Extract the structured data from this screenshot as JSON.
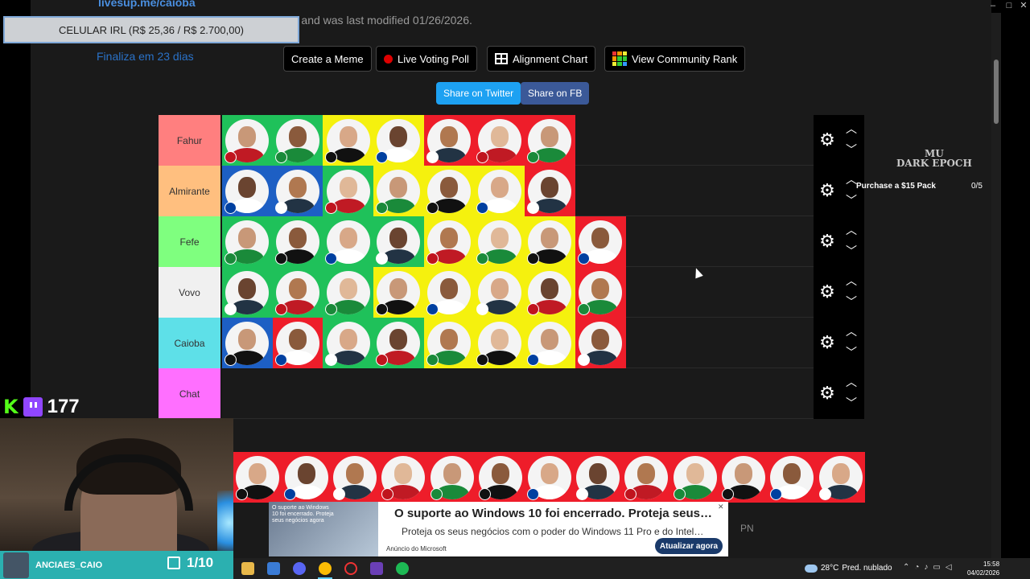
{
  "window": {
    "minimize_glyph": "–",
    "maximize_glyph": "□",
    "close_glyph": "✕"
  },
  "header": {
    "url": "livesup.me/caioba",
    "info": "This tier list has 622 images and was last modified 01/26/2026.",
    "goal": "CELULAR IRL (R$ 25,36 / R$ 2.700,00)",
    "countdown": "Finaliza em 23 dias"
  },
  "toolbar": {
    "create_meme": "Create a Meme",
    "live_poll": "Live Voting Poll",
    "alignment": "Alignment Chart",
    "community": "View Community Rank",
    "share_twitter": "Share on Twitter",
    "share_fb": "Share on FB"
  },
  "colors": {
    "twitter": "#1da1f2",
    "facebook": "#3b5998",
    "tier_fahur": "#ff7f7f",
    "tier_almirante": "#ffbf7f",
    "tier_fefe": "#7fff7f",
    "tier_vovo": "#f0f0f0",
    "tier_caioba": "#5ee0e8",
    "tier_chat": "#ff6fff",
    "chip_green": "#1fc15a",
    "chip_yellow": "#f5f10e",
    "chip_red": "#ee1d2a",
    "chip_blue": "#1d5fc4"
  },
  "tiers": [
    {
      "label": "Fahur",
      "chips": [
        "green",
        "green",
        "yellow",
        "yellow",
        "red",
        "red",
        "red"
      ]
    },
    {
      "label": "Almirante",
      "chips": [
        "blue",
        "blue",
        "green",
        "yellow",
        "yellow",
        "yellow",
        "red"
      ]
    },
    {
      "label": "Fefe",
      "chips": [
        "green",
        "green",
        "green",
        "green",
        "yellow",
        "yellow",
        "yellow",
        "red"
      ]
    },
    {
      "label": "Vovo",
      "chips": [
        "green",
        "green",
        "green",
        "yellow",
        "yellow",
        "yellow",
        "yellow",
        "red"
      ]
    },
    {
      "label": "Caioba",
      "chips": [
        "blue",
        "red",
        "green",
        "green",
        "yellow",
        "yellow",
        "yellow",
        "red"
      ]
    },
    {
      "label": "Chat",
      "chips": []
    }
  ],
  "row_controls": {
    "settings_icon": "gear-icon",
    "up_icon": "chevron-up-icon",
    "down_icon": "chevron-down-icon"
  },
  "side_ad": {
    "logo_line1": "MU",
    "logo_line2": "DARK EPOCH",
    "offer": "Purchase a $15 Pack",
    "progress": "0/5"
  },
  "pool_count": 13,
  "stream": {
    "viewers": "177",
    "handle": "ANCIAES_CAIO",
    "counter": "1/10"
  },
  "bottom_ad": {
    "image_text": "O suporte ao Windows 10 foi encerrado. Proteja seus negócios agora",
    "title": "O suporte ao Windows 10 foi encerrado. Proteja seus…",
    "subtitle": "Proteja os seus negócios com o poder do Windows 11 Pro e do Intel…",
    "sponsor": "Anúncio do Microsoft",
    "cta": "Atualizar agora",
    "close": "✕"
  },
  "pn_label": "PN",
  "taskbar": {
    "temperature": "28°C",
    "weather": "Pred. nublado",
    "time": "15:58",
    "date": "04/02/2026"
  }
}
